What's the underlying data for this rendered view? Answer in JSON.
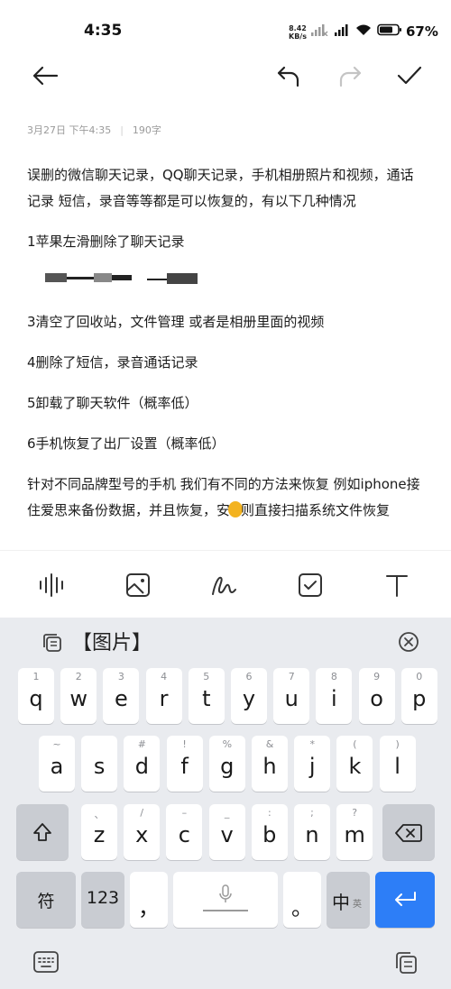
{
  "status": {
    "time": "4:35",
    "net_speed_value": "8.42",
    "net_speed_unit": "KB/s",
    "battery": "67%"
  },
  "meta": {
    "date": "3月27日 下午4:35",
    "separator": "|",
    "word_count": "190字"
  },
  "note": {
    "p1": "误删的微信聊天记录，QQ聊天记录，手机相册照片和视频，通话记录 短信，录音等等都是可以恢复的，有以下几种情况",
    "p2": "1苹果左滑删除了聊天记录",
    "p3": "3清空了回收站，文件管理 或者是相册里面的视频",
    "p4": "4删除了短信，录音通话记录",
    "p5": "5卸载了聊天软件（概率低）",
    "p6": "6手机恢复了出厂设置（概率低）",
    "p7a": "针对不同品牌型号的手机 我们有不同的方法来恢复 例如iphone接住爱思来备份数据，并且恢复，安",
    "p7b": "则直接扫描系统文件恢复"
  },
  "keyboard": {
    "suggestion": "【图片】",
    "row1": [
      {
        "hint": "1",
        "key": "q"
      },
      {
        "hint": "2",
        "key": "w"
      },
      {
        "hint": "3",
        "key": "e"
      },
      {
        "hint": "4",
        "key": "r"
      },
      {
        "hint": "5",
        "key": "t"
      },
      {
        "hint": "6",
        "key": "y"
      },
      {
        "hint": "7",
        "key": "u"
      },
      {
        "hint": "8",
        "key": "i"
      },
      {
        "hint": "9",
        "key": "o"
      },
      {
        "hint": "0",
        "key": "p"
      }
    ],
    "row2": [
      {
        "hint": "~",
        "key": "a"
      },
      {
        "hint": "",
        "key": "s"
      },
      {
        "hint": "#",
        "key": "d"
      },
      {
        "hint": "!",
        "key": "f"
      },
      {
        "hint": "%",
        "key": "g"
      },
      {
        "hint": "&",
        "key": "h"
      },
      {
        "hint": "*",
        "key": "j"
      },
      {
        "hint": "(",
        "key": "k"
      },
      {
        "hint": ")",
        "key": "l"
      }
    ],
    "row3": [
      {
        "hint": "、",
        "key": "z"
      },
      {
        "hint": "/",
        "key": "x"
      },
      {
        "hint": "–",
        "key": "c"
      },
      {
        "hint": "_",
        "key": "v"
      },
      {
        "hint": ":",
        "key": "b"
      },
      {
        "hint": ";",
        "key": "n"
      },
      {
        "hint": "?",
        "key": "m"
      }
    ],
    "symbols_label": "符",
    "numbers_label": "123",
    "comma_label": "，",
    "period_label": "。",
    "lang_main": "中",
    "lang_sub": "英"
  },
  "colors": {
    "accent": "#2d7ef7",
    "caret": "#f3b320",
    "keyboard_bg": "#e9ebef"
  },
  "icons": {
    "back": "arrow-left-icon",
    "undo": "undo-icon",
    "redo": "redo-icon",
    "done": "check-icon",
    "voice": "waveform-icon",
    "image": "image-icon",
    "draw": "scribble-icon",
    "checklist": "checkbox-icon",
    "text": "text-format-icon"
  }
}
